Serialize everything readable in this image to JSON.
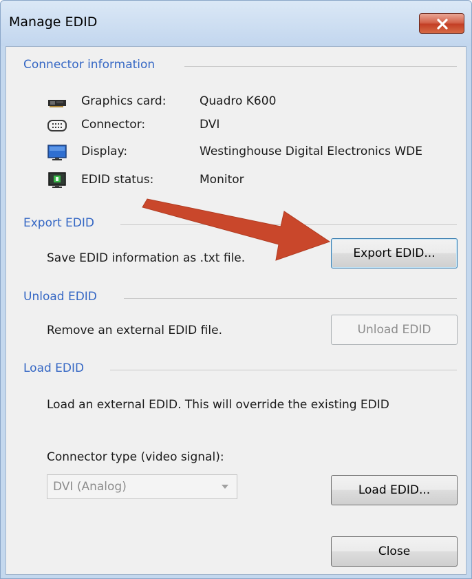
{
  "window": {
    "title": "Manage EDID"
  },
  "connector_info": {
    "heading": "Connector information",
    "rows": [
      {
        "icon": "graphics-card-icon",
        "label": "Graphics card:",
        "value": "Quadro K600"
      },
      {
        "icon": "connector-icon",
        "label": "Connector:",
        "value": "DVI"
      },
      {
        "icon": "display-icon",
        "label": "Display:",
        "value": "Westinghouse Digital Electronics WDE"
      },
      {
        "icon": "edid-status-icon",
        "label": "EDID status:",
        "value": "Monitor"
      }
    ]
  },
  "export": {
    "heading": "Export EDID",
    "description": "Save EDID information as .txt file.",
    "button_label": "Export EDID..."
  },
  "unload": {
    "heading": "Unload EDID",
    "description": "Remove an external EDID file.",
    "button_label": "Unload EDID"
  },
  "load": {
    "heading": "Load EDID",
    "description": "Load an external EDID. This will override the existing EDID",
    "connector_type_label": "Connector type (video signal):",
    "connector_type_value": "DVI (Analog)",
    "button_label": "Load EDID..."
  },
  "footer": {
    "close_label": "Close"
  },
  "colors": {
    "heading": "#3567c4",
    "annotation_arrow": "#c9472b",
    "close_button": "#c94429"
  }
}
